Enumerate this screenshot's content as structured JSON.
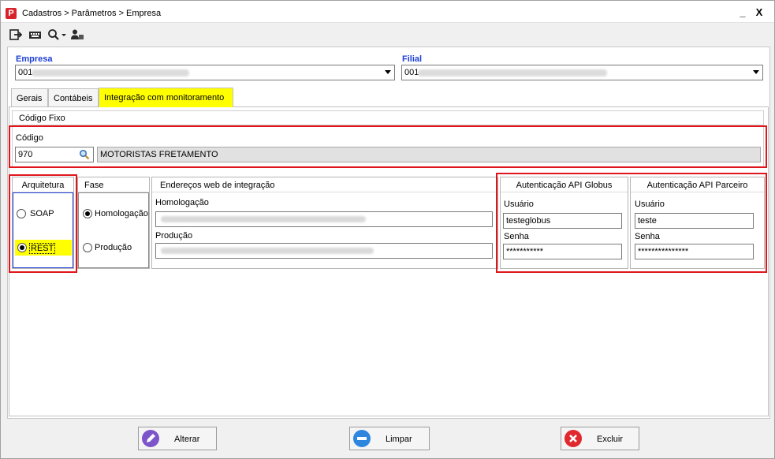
{
  "window": {
    "title": "Cadastros > Parâmetros > Empresa",
    "app_icon_glyph": "P",
    "minimize_glyph": "_",
    "close_glyph": "X"
  },
  "toolbar": {
    "icons": [
      "exit-icon",
      "keyboard-icon",
      "search-dropdown-icon",
      "user-settings-icon"
    ]
  },
  "empresa": {
    "label": "Empresa",
    "value_prefix": "001 -"
  },
  "filial": {
    "label": "Filial",
    "value_prefix": "001 -"
  },
  "tabs": [
    {
      "label": "Gerais",
      "active": false
    },
    {
      "label": "Contábeis",
      "active": false
    },
    {
      "label": "Integração com monitoramento",
      "active": true
    }
  ],
  "codigo_fixo": {
    "header": "Código Fixo",
    "codigo_label": "Código",
    "codigo_value": "970",
    "descricao_value": "MOTORISTAS FRETAMENTO"
  },
  "arquitetura": {
    "header": "Arquitetura",
    "options": [
      {
        "label": "SOAP",
        "checked": false
      },
      {
        "label": "REST",
        "checked": true
      }
    ]
  },
  "fase": {
    "header": "Fase",
    "options": [
      {
        "label": "Homologação",
        "checked": true
      },
      {
        "label": "Produção",
        "checked": false
      }
    ]
  },
  "enderecos": {
    "header": "Endereços web de integração",
    "homologacao_label": "Homologação",
    "producao_label": "Produção"
  },
  "auth_globus": {
    "header": "Autenticação API Globus",
    "usuario_label": "Usuário",
    "usuario_value": "testeglobus",
    "senha_label": "Senha",
    "senha_value": "***********"
  },
  "auth_parceiro": {
    "header": "Autenticação API Parceiro",
    "usuario_label": "Usuário",
    "usuario_value": "teste",
    "senha_label": "Senha",
    "senha_value": "***************"
  },
  "buttons": {
    "alterar": "Alterar",
    "limpar": "Limpar",
    "excluir": "Excluir"
  },
  "colors": {
    "highlight_yellow": "#ffff00",
    "annotation_red": "#e0151b",
    "label_blue": "#1c3fd6"
  }
}
